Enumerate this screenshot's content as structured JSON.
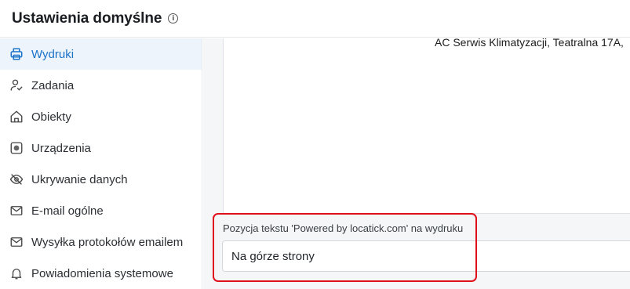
{
  "header": {
    "title": "Ustawienia domyślne",
    "info_icon": "info-icon"
  },
  "sidebar": {
    "items": [
      {
        "label": "Wydruki",
        "icon": "printer-icon",
        "active": true
      },
      {
        "label": "Zadania",
        "icon": "user-check-icon",
        "active": false
      },
      {
        "label": "Obiekty",
        "icon": "home-icon",
        "active": false
      },
      {
        "label": "Urządzenia",
        "icon": "device-icon",
        "active": false
      },
      {
        "label": "Ukrywanie danych",
        "icon": "eye-off-icon",
        "active": false
      },
      {
        "label": "E-mail ogólne",
        "icon": "mail-icon",
        "active": false
      },
      {
        "label": "Wysyłka protokołów emailem",
        "icon": "mail-icon",
        "active": false
      },
      {
        "label": "Powiadomienia systemowe",
        "icon": "bell-icon",
        "active": false
      }
    ]
  },
  "main": {
    "preview_text": "AC Serwis Klimatyzacji, Teatralna 17A,",
    "position_field": {
      "label": "Pozycja tekstu 'Powered by locatick.com' na wydruku",
      "value": "Na górze strony"
    }
  },
  "colors": {
    "accent": "#1a73c9",
    "highlight": "#e0101a",
    "active_bg": "#eef4fb"
  }
}
